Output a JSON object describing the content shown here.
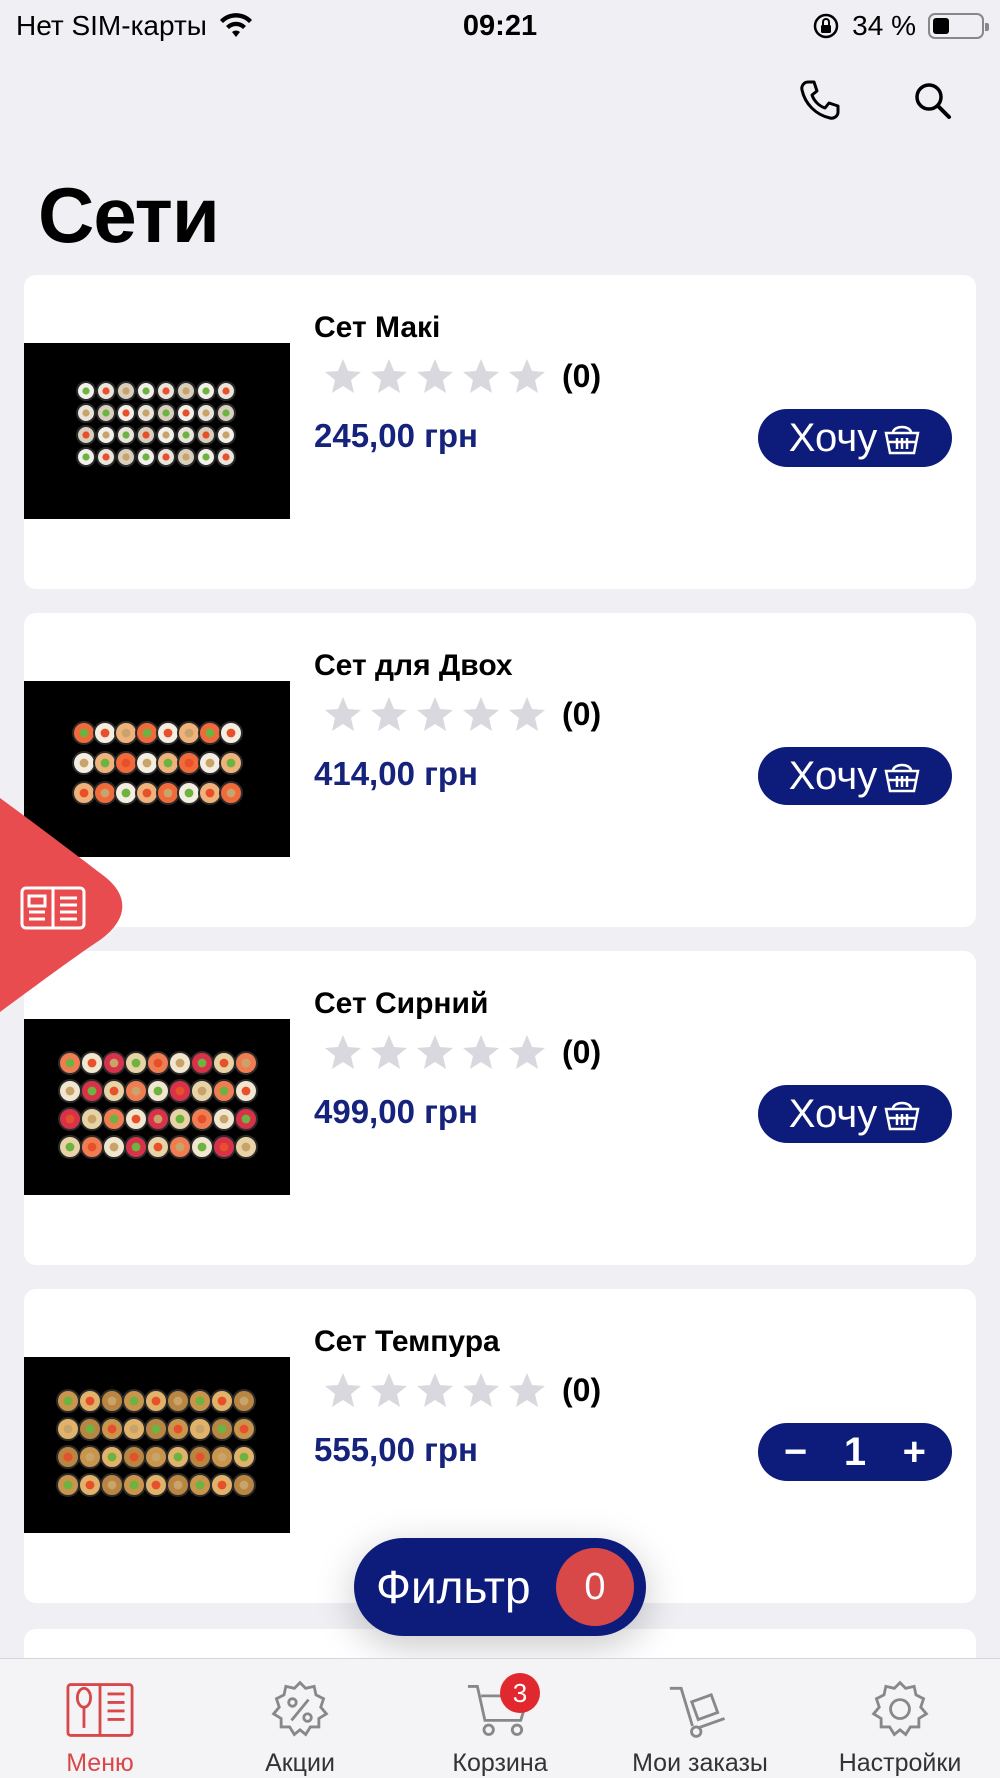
{
  "status_bar": {
    "carrier": "Нет SIM-карты",
    "time": "09:21",
    "battery": "34 %",
    "battery_level": 0.34
  },
  "header": {
    "phone_icon": "phone-icon",
    "search_icon": "search-icon",
    "title": "Сети"
  },
  "products": [
    {
      "name": "Сет Макі",
      "rating_count": "(0)",
      "rating": 0,
      "price": "245,00 грн",
      "action": "Хочу"
    },
    {
      "name": "Сет для Двох",
      "rating_count": "(0)",
      "rating": 0,
      "price": "414,00 грн",
      "action": "Хочу"
    },
    {
      "name": "Сет Сирний",
      "rating_count": "(0)",
      "rating": 0,
      "price": "499,00 грн",
      "action": "Хочу"
    },
    {
      "name": "Сет Темпура",
      "rating_count": "(0)",
      "rating": 0,
      "price": "555,00 грн",
      "quantity": "1",
      "minus": "−",
      "plus": "+"
    }
  ],
  "filter": {
    "label": "Фильтр",
    "count": "0"
  },
  "tab_bar": {
    "items": [
      {
        "label": "Меню",
        "icon": "menu-book-icon",
        "active": true
      },
      {
        "label": "Акции",
        "icon": "discount-gear-icon"
      },
      {
        "label": "Корзина",
        "icon": "cart-icon",
        "badge": "3"
      },
      {
        "label": "Мои заказы",
        "icon": "delivery-cart-icon"
      },
      {
        "label": "Настройки",
        "icon": "settings-gear-icon"
      }
    ]
  },
  "colors": {
    "brand": "#0d1b7a",
    "price": "#15237c",
    "accent": "#d94848",
    "background": "#efeff4"
  }
}
